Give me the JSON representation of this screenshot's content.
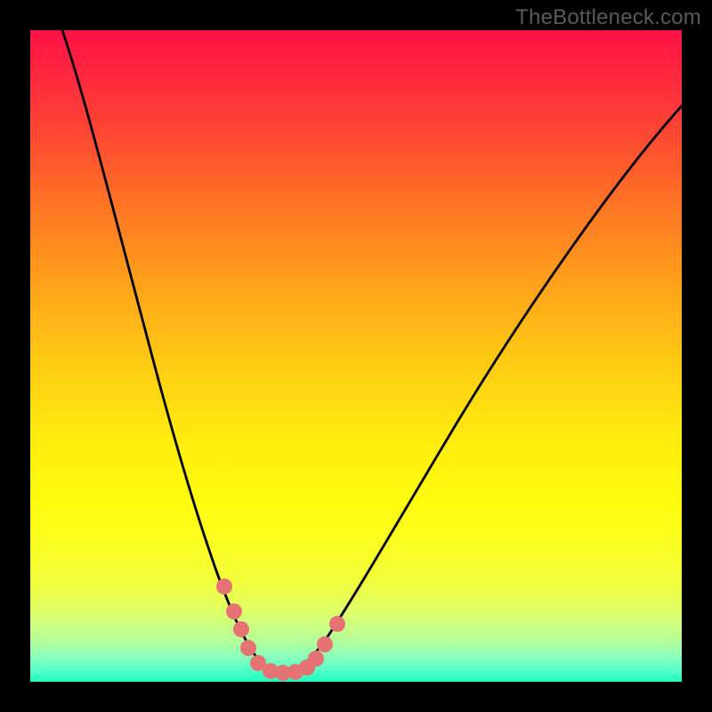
{
  "watermark": "TheBottleneck.com",
  "colors": {
    "frame": "#000000",
    "curve": "#000000",
    "marker": "#e57373"
  },
  "chart_data": {
    "type": "line",
    "title": "",
    "xlabel": "",
    "ylabel": "",
    "xlim": [
      0,
      100
    ],
    "ylim": [
      0,
      100
    ],
    "grid": false,
    "legend": false,
    "series": [
      {
        "name": "bottleneck-curve",
        "x": [
          5,
          10,
          15,
          20,
          24,
          27,
          29,
          31,
          33,
          35,
          37,
          40,
          44,
          50,
          57,
          65,
          75,
          85,
          95,
          100
        ],
        "y": [
          100,
          82,
          64,
          46,
          30,
          19,
          12,
          7,
          4,
          2,
          1,
          1,
          3,
          8,
          17,
          29,
          44,
          58,
          70,
          75
        ]
      }
    ],
    "markers": {
      "name": "highlighted-points",
      "x": [
        29,
        31,
        32,
        33,
        35,
        37,
        39,
        41,
        43,
        44,
        45,
        46
      ],
      "y": [
        12,
        7,
        5,
        3,
        1,
        1,
        1,
        1,
        2,
        3,
        5,
        8
      ]
    },
    "annotations": []
  }
}
